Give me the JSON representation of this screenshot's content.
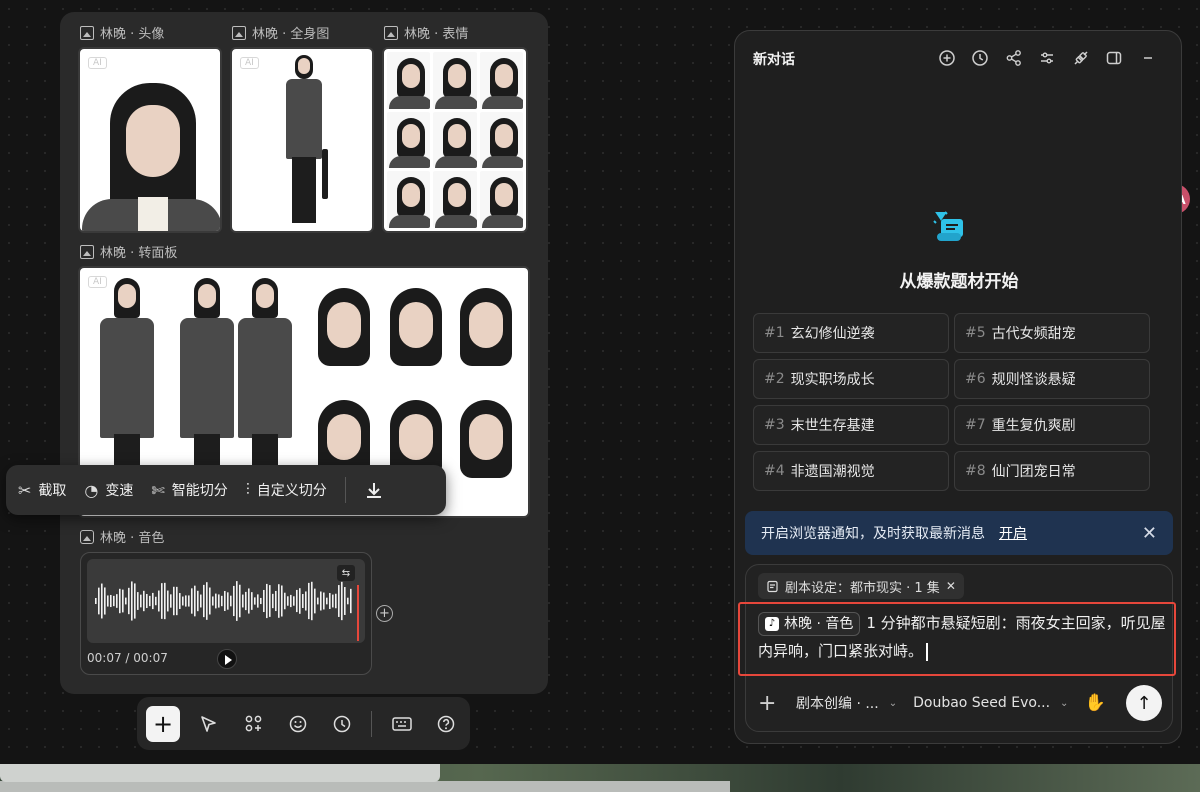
{
  "canvas": {
    "labels": {
      "avatar": "林晚 · 头像",
      "fullbody": "林晚 · 全身图",
      "expression": "林晚 · 表情",
      "turnaround": "林晚 · 转面板",
      "voice": "林晚 · 音色"
    },
    "audio": {
      "time": "00:07 / 00:07"
    }
  },
  "float_toolbar": {
    "items": [
      {
        "label": "截取",
        "icon": "scissors-icon"
      },
      {
        "label": "变速",
        "icon": "speed-icon"
      },
      {
        "label": "智能切分",
        "icon": "smart-split-icon"
      },
      {
        "label": "自定义切分",
        "icon": "custom-split-icon"
      }
    ],
    "download_icon": "download-icon"
  },
  "dock": {
    "items": [
      "plus-icon",
      "pointer-icon",
      "apps-icon",
      "emoji-icon",
      "clock-icon",
      "keyboard-icon",
      "help-icon"
    ]
  },
  "chat": {
    "title": "新对话",
    "heading": "从爆款题材开始",
    "topics": [
      {
        "num": "#1",
        "label": "玄幻修仙逆袭"
      },
      {
        "num": "#5",
        "label": "古代女频甜宠"
      },
      {
        "num": "#2",
        "label": "现实职场成长"
      },
      {
        "num": "#6",
        "label": "规则怪谈悬疑"
      },
      {
        "num": "#3",
        "label": "末世生存基建"
      },
      {
        "num": "#7",
        "label": "重生复仇爽剧"
      },
      {
        "num": "#4",
        "label": "非遗国潮视觉"
      },
      {
        "num": "#8",
        "label": "仙门团宠日常"
      }
    ],
    "notice": {
      "text": "开启浏览器通知，及时获取最新消息",
      "link": "开启"
    },
    "scope_chip": "剧本设定：都市现实 · 1 集",
    "message": {
      "chip": "林晚 · 音色",
      "text": "1 分钟都市悬疑短剧：雨夜女主回家，听见屋内异响，门口紧张对峙。"
    },
    "footer": {
      "mode": "剧本创编 · ...",
      "model": "Doubao Seed Evo..."
    }
  },
  "colors": {
    "accent_highlight": "#e6473b",
    "notice_bg": "#1f3350",
    "hero_icon": "#2fc2e8"
  }
}
